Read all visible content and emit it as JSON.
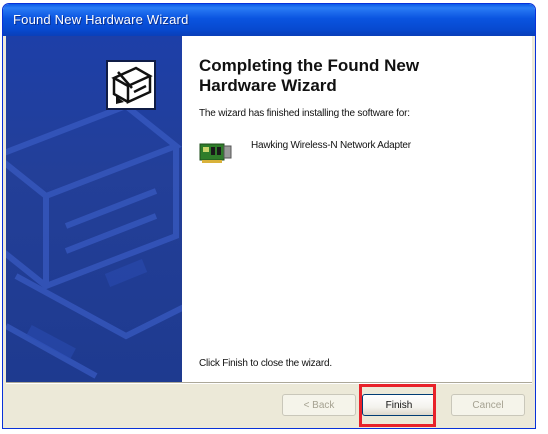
{
  "window": {
    "title": "Found New Hardware Wizard"
  },
  "content": {
    "heading_line1": "Completing the Found New",
    "heading_line2": "Hardware Wizard",
    "intro": "The wizard has finished installing the software for:",
    "device_name": "Hawking Wireless-N Network Adapter",
    "close_instruction": "Click Finish to close the wizard."
  },
  "buttons": {
    "back_label": "< Back",
    "finish_label": "Finish",
    "cancel_label": "Cancel"
  },
  "icons": {
    "wizard": "hardware-box-icon",
    "device": "network-card-icon"
  },
  "colors": {
    "title_bar": "#0a54e0",
    "side_panel": "#233f98",
    "highlight": "#e8222a"
  }
}
